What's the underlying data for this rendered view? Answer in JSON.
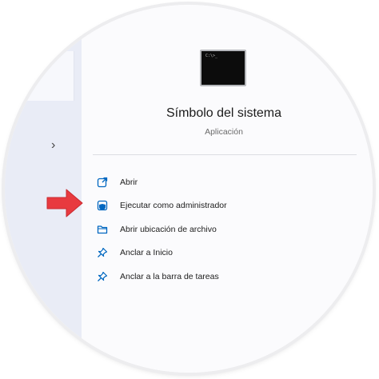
{
  "app": {
    "title": "Símbolo del sistema",
    "subtitle": "Aplicación",
    "tile_prompt": "C:\\>_",
    "tile_color": "#0c0c0c"
  },
  "nav": {
    "chevron": "›"
  },
  "menu": {
    "accent": "#0067c0",
    "items": [
      {
        "label": "Abrir",
        "icon": "open-external-icon"
      },
      {
        "label": "Ejecutar como administrador",
        "icon": "shield-admin-icon"
      },
      {
        "label": "Abrir ubicación de archivo",
        "icon": "folder-icon"
      },
      {
        "label": "Anclar a Inicio",
        "icon": "pin-icon"
      },
      {
        "label": "Anclar a la barra de tareas",
        "icon": "pin-icon"
      }
    ]
  },
  "annotation": {
    "arrow_color": "#e83a3f",
    "arrow_target": "menu.items.1"
  }
}
